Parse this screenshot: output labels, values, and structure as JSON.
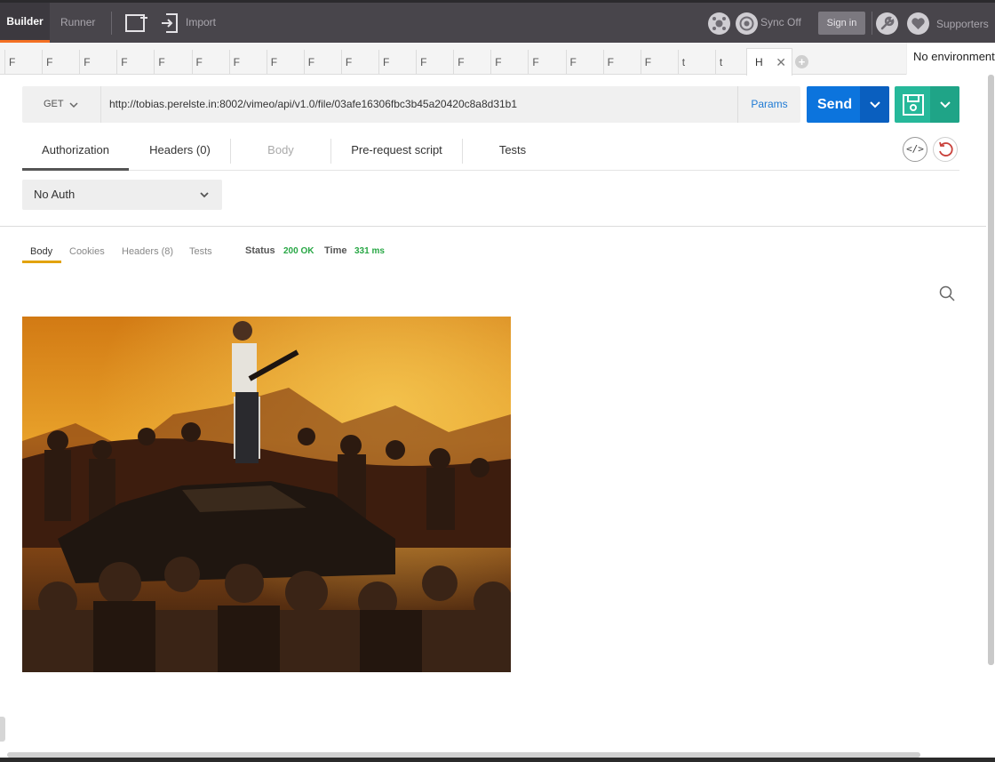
{
  "toolbar": {
    "builder": "Builder",
    "runner": "Runner",
    "import": "Import",
    "sync": "Sync Off",
    "sign_in": "Sign in",
    "supporters": "Supporters"
  },
  "tabs": {
    "items": [
      "F",
      "F",
      "F",
      "F",
      "F",
      "F",
      "F",
      "F",
      "F",
      "F",
      "F",
      "F",
      "F",
      "F",
      "F",
      "F",
      "F",
      "F",
      "t",
      "t"
    ],
    "active": "H",
    "environment": "No environment"
  },
  "request": {
    "method": "GET",
    "url": "http://tobias.perelste.in:8002/vimeo/api/v1.0/file/03afe16306fbc3b45a20420c8a8d31b1",
    "params": "Params",
    "send": "Send"
  },
  "request_tabs": {
    "authorization": "Authorization",
    "headers": "Headers (0)",
    "body": "Body",
    "prerequest": "Pre-request script",
    "tests": "Tests"
  },
  "auth": {
    "type": "No Auth"
  },
  "response": {
    "tabs": {
      "body": "Body",
      "cookies": "Cookies",
      "headers": "Headers (8)",
      "tests": "Tests"
    },
    "status_label": "Status",
    "status_value": "200 OK",
    "time_label": "Time",
    "time_value": "331 ms"
  },
  "colors": {
    "accent_orange": "#f47023",
    "send_blue": "#0c74dd",
    "save_teal": "#26b89a",
    "status_green": "#28a745"
  }
}
